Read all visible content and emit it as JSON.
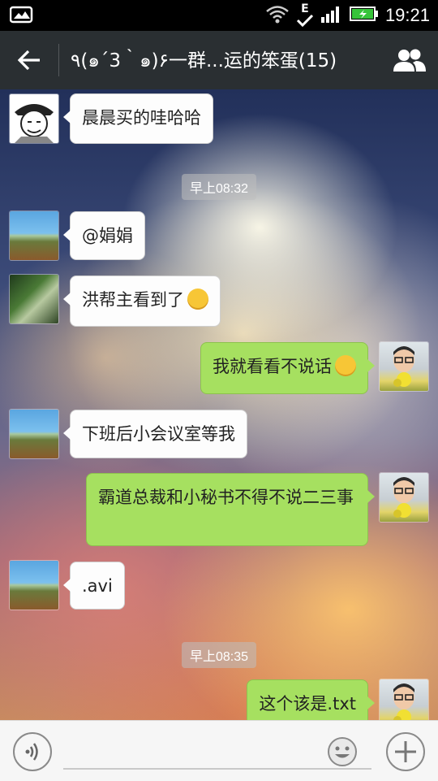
{
  "status_bar": {
    "time": "19:21",
    "network_label": "E"
  },
  "header": {
    "title": "٩(๑´3｀๑)۶一群...运的笨蛋(15)"
  },
  "messages": [
    {
      "type": "in",
      "avatar": "manga-avatar",
      "text": "晨晨买的哇哈哈"
    },
    {
      "type": "time",
      "text": "早上08:32"
    },
    {
      "type": "in",
      "avatar": "field-avatar",
      "text": "@娟娟"
    },
    {
      "type": "in",
      "avatar": "park-avatar",
      "text": "洪帮主看到了"
    },
    {
      "type": "out",
      "avatar": "me-avatar",
      "text": "我就看看不说话"
    },
    {
      "type": "in",
      "avatar": "field-avatar",
      "text": "下班后小会议室等我"
    },
    {
      "type": "out",
      "avatar": "me-avatar",
      "text": "霸道总裁和小秘书不得不说二三事"
    },
    {
      "type": "in",
      "avatar": "field-avatar",
      "text": ".avi"
    },
    {
      "type": "time",
      "text": "早上08:35"
    },
    {
      "type": "out",
      "avatar": "me-avatar",
      "text": "这个该是.txt"
    }
  ],
  "input": {
    "placeholder": ""
  },
  "colors": {
    "outgoing_bubble": "#a6e060",
    "incoming_bubble": "#fdfdfd",
    "titlebar": "#2a2f32"
  }
}
